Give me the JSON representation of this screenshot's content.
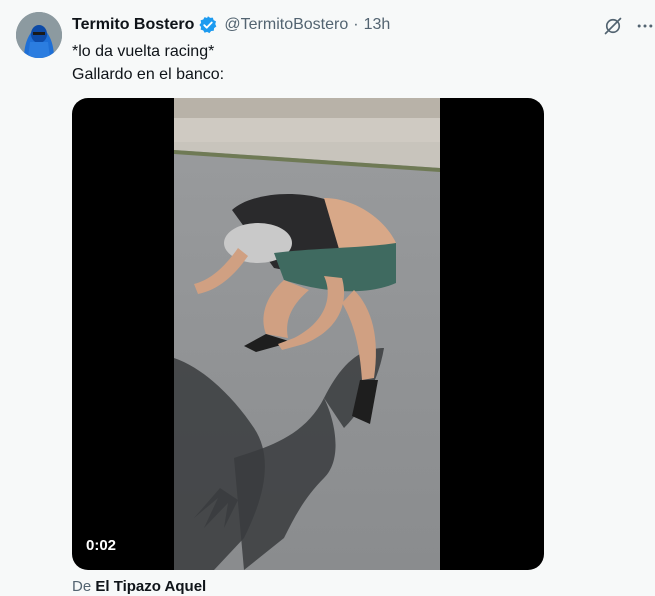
{
  "tweet": {
    "display_name": "Termito Bostero",
    "handle": "@TermitoBostero",
    "separator": "·",
    "time": "13h",
    "text_lines": [
      "*lo da vuelta racing*",
      "Gallardo en el banco:"
    ],
    "verified_color": "#1d9bf0"
  },
  "media": {
    "duration": "0:02"
  },
  "attribution": {
    "prefix": "De",
    "source": "El Tipazo Aquel"
  },
  "icons": [
    "grok-icon",
    "more-icon",
    "verified-badge-icon"
  ]
}
